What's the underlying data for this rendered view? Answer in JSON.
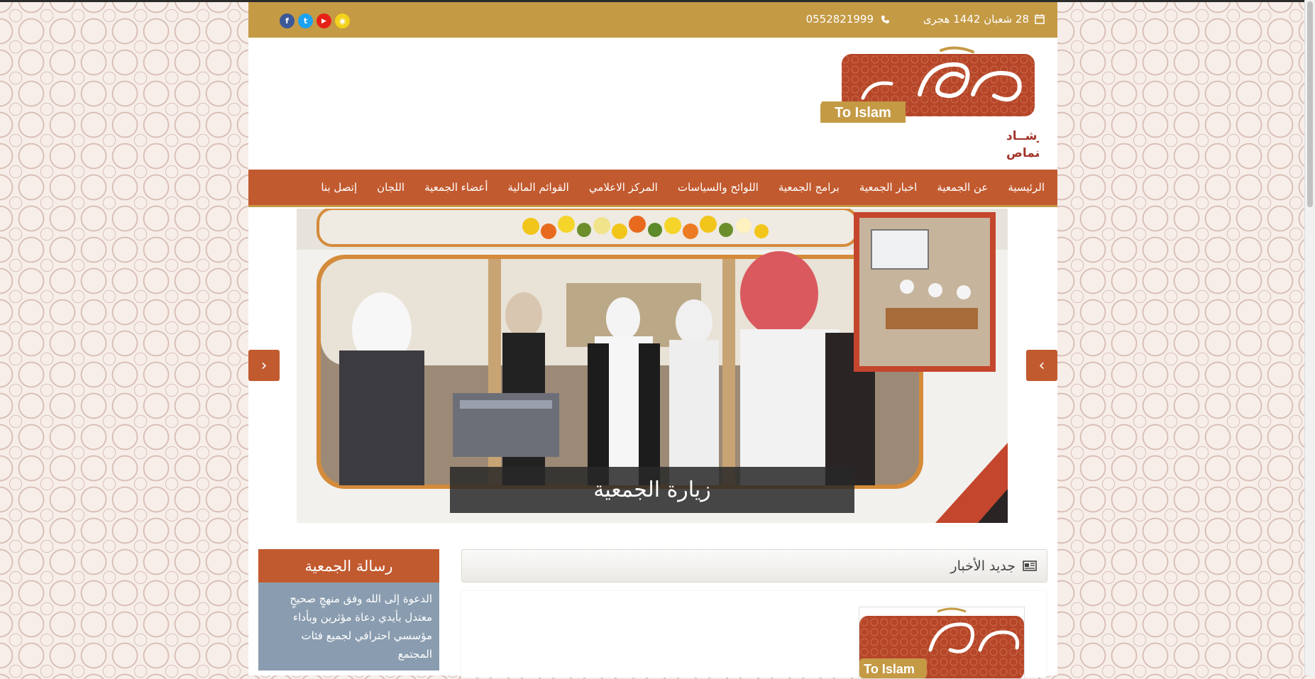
{
  "topbar": {
    "date": "28 شعبان 1442 هجرى",
    "phone": "0552821999",
    "icons": [
      "calendar-icon",
      "phone-icon"
    ],
    "social": [
      {
        "name": "snapchat",
        "color": "#f2d21a",
        "glyph": "◉"
      },
      {
        "name": "youtube",
        "color": "#e62117",
        "glyph": "▶"
      },
      {
        "name": "twitter",
        "color": "#1da1f2",
        "glyph": "t"
      },
      {
        "name": "facebook",
        "color": "#3b5998",
        "glyph": "f"
      }
    ]
  },
  "logo": {
    "badge": "To Islam",
    "line1": "جمعيـة الدعـوة والإرشــاد",
    "line2": "وتوعية الجاليات بالنماص"
  },
  "nav": {
    "items": [
      "الرئيسية",
      "عن الجمعية",
      "اخبار الجمعية",
      "برامج الجمعية",
      "اللوائح والسياسات",
      "المركز الاعلامي",
      "القوائم المالية",
      "أعضاء الجمعية",
      "اللجان",
      "إتصل بنا"
    ]
  },
  "slider": {
    "caption": "زيارة الجمعية",
    "prev": "‹",
    "next": "›"
  },
  "news": {
    "title": "جديد الأخبار",
    "icon": "newspaper-icon"
  },
  "mission": {
    "title": "رسالة الجمعية",
    "body": "الدعوة إلى الله وفق منهجٍ صحيحٍ معتدل بأيدي دعاة مؤثرين وبأداء مؤسسي احترافي لجميع فئات المجتمع"
  },
  "colors": {
    "gold": "#c49a45",
    "brand_red": "#c25a2f",
    "mission_body": "#8a9db0"
  }
}
